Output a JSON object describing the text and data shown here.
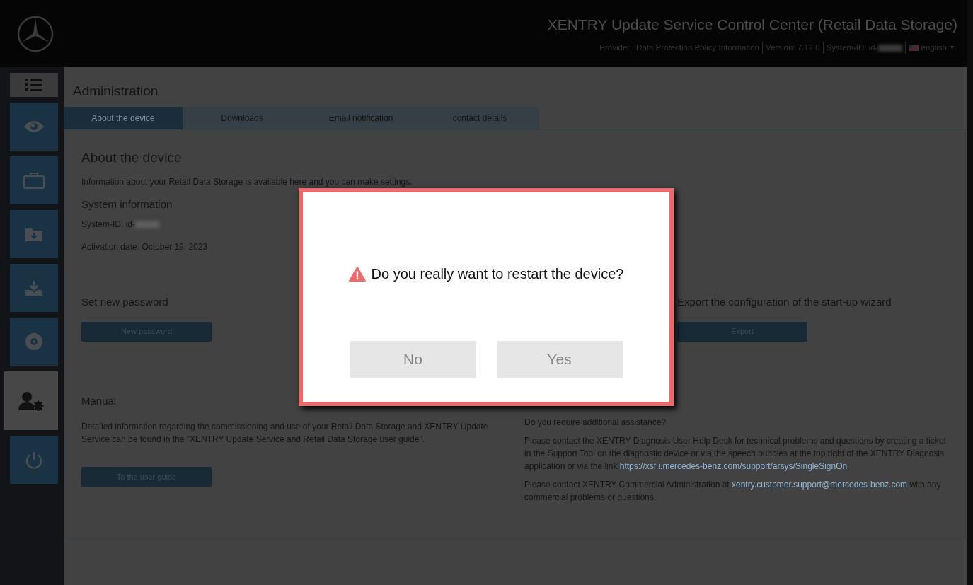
{
  "header": {
    "title": "XENTRY Update Service Control Center (Retail Data Storage)",
    "links": [
      {
        "text": "Provider",
        "redacted": false
      },
      {
        "text": "Data Protection Policy Information",
        "redacted": false
      },
      {
        "text": "Version: 7.12.0",
        "redacted": false
      },
      {
        "text": "System-ID: id-",
        "redacted": true
      }
    ],
    "language": "english"
  },
  "sidebar": {
    "items": [
      {
        "kind": "menu",
        "selected": false
      },
      {
        "kind": "eye",
        "selected": false
      },
      {
        "kind": "case",
        "selected": false
      },
      {
        "kind": "folder",
        "selected": false
      },
      {
        "kind": "download",
        "selected": false
      },
      {
        "kind": "disc",
        "selected": false
      },
      {
        "kind": "admin",
        "selected": true
      },
      {
        "kind": "power",
        "selected": false
      }
    ]
  },
  "page_title": "Administration",
  "tabs": [
    {
      "label": "About the device",
      "selected": true
    },
    {
      "label": "Downloads",
      "selected": false
    },
    {
      "label": "Email notification",
      "selected": false
    },
    {
      "label": "contact details",
      "selected": false
    }
  ],
  "section": {
    "title": "About the device",
    "intro": "Information about your Retail Data Storage is available here and you can make settings.",
    "system_info": {
      "title": "System information",
      "system_id": "System-ID: id-",
      "activation": "Activation date: October 19, 2023"
    },
    "actions": [
      {
        "title": "Set new password",
        "button": "New password"
      },
      {
        "title": "Export the configuration of the start-up wizard",
        "button": "Export"
      }
    ],
    "manual": {
      "title": "Manual",
      "text": "Detailed information regarding the commissioning and use of your Retail Data Storage and XENTRY Update Service can be found in the \"XENTRY Update Service and Retail Data Storage user guide\".",
      "button": "To the user guide"
    },
    "assistance": [
      {
        "before": "Do you require additional assistance?"
      },
      {
        "before": "Please contact the XENTRY Diagnosis User Help Desk for technical problems and questions by creating a ticket in the Support Tool on the diagnostic device or via the speech bubbles at the top right of the XENTRY Diagnosis application or via the link ",
        "link": "https://xsf.i.mercedes-benz.com/support/arsys/SingleSignOn",
        "after": "."
      },
      {
        "before": "Please contact XENTRY Commercial Administration at ",
        "link": "xentry.customer.support@mercedes-benz.com",
        "after": " with any commercial problems or questions."
      }
    ]
  },
  "dialog": {
    "message": "Do you really want to restart the device?",
    "buttons": [
      "No",
      "Yes"
    ]
  }
}
